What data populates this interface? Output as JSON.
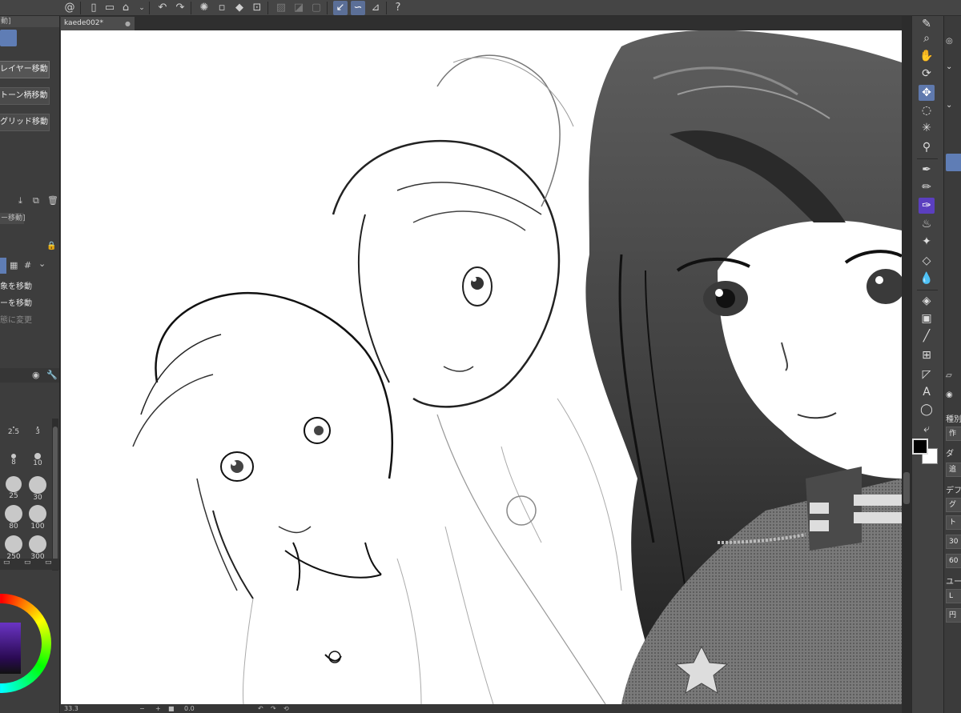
{
  "document": {
    "tab_label": "kaede002*",
    "close_glyph": "●"
  },
  "left_panel": {
    "header_1": "動]",
    "mode_buttons": [
      "レイヤー移動",
      "トーン柄移動",
      "グリッド移動"
    ],
    "header_2": "ー移動]",
    "options": [
      "象を移動",
      "ーを移動",
      "態に変更"
    ],
    "brush_sizes": [
      "2.5",
      "3",
      "8",
      "10",
      "25",
      "30",
      "80",
      "100",
      "250",
      "300"
    ]
  },
  "status_bar": {
    "zoom": "33.3",
    "minus": "−",
    "plus": "+",
    "angle": "0.0"
  },
  "right_panel": {
    "items": [
      "種別",
      "作",
      "ダ",
      "追",
      "デフ",
      "グ",
      "ト",
      "30",
      "60",
      "ユー",
      "L",
      "円"
    ]
  },
  "colors": {
    "accent": "#5f7db5",
    "active_tool": "#5f79ad",
    "pen_tool": "#5b3fbf",
    "foreground": "#000000",
    "background": "#ffffff"
  },
  "icons": {
    "toolbar": [
      "app-logo-icon",
      "new-file-icon",
      "open-icon",
      "save-icon",
      "undo-icon",
      "redo-icon",
      "loading-icon",
      "fill-icon",
      "crop-icon",
      "ruler-icon",
      "help-icon"
    ],
    "tools": [
      "brush-icon",
      "zoom-icon",
      "hand-icon",
      "rotate-icon",
      "move-icon",
      "lasso-icon",
      "magic-wand-icon",
      "eyedropper-icon",
      "pen-icon",
      "pencil-icon",
      "marker-icon",
      "airbrush-icon",
      "decoration-icon",
      "eraser-icon",
      "blend-icon",
      "fill-icon",
      "gradient-icon",
      "line-icon",
      "frame-icon",
      "ruler-icon",
      "text-icon",
      "balloon-icon",
      "correct-line-icon"
    ]
  }
}
